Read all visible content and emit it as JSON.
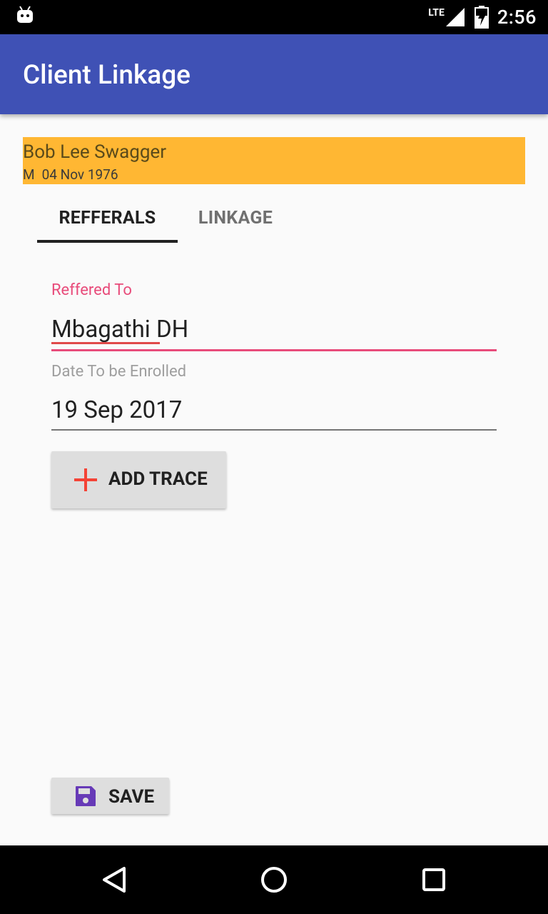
{
  "status_bar": {
    "network": "LTE",
    "time": "2:56"
  },
  "app_bar": {
    "title": "Client Linkage"
  },
  "client": {
    "name": "Bob Lee Swagger",
    "sex": "M",
    "dob": "04 Nov 1976"
  },
  "tabs": [
    {
      "label": "REFFERALS",
      "selected": true
    },
    {
      "label": "LINKAGE",
      "selected": false
    }
  ],
  "form": {
    "referred_to_label": "Reffered To",
    "referred_to_value": "Mbagathi DH",
    "date_label": "Date To be Enrolled",
    "date_value": "19 Sep 2017"
  },
  "buttons": {
    "add_trace_label": "ADD TRACE",
    "save_label": "SAVE"
  },
  "colors": {
    "app_bar": "#3f51b5",
    "banner": "#ffb733",
    "accent": "#e84b7a",
    "plus_icon": "#f44336",
    "save_icon": "#673ab7"
  },
  "icons": {
    "status_left": "android-icon",
    "add_trace": "plus-icon",
    "save": "floppy-disk-icon",
    "nav": [
      "back-icon",
      "home-icon",
      "recent-apps-icon"
    ]
  }
}
